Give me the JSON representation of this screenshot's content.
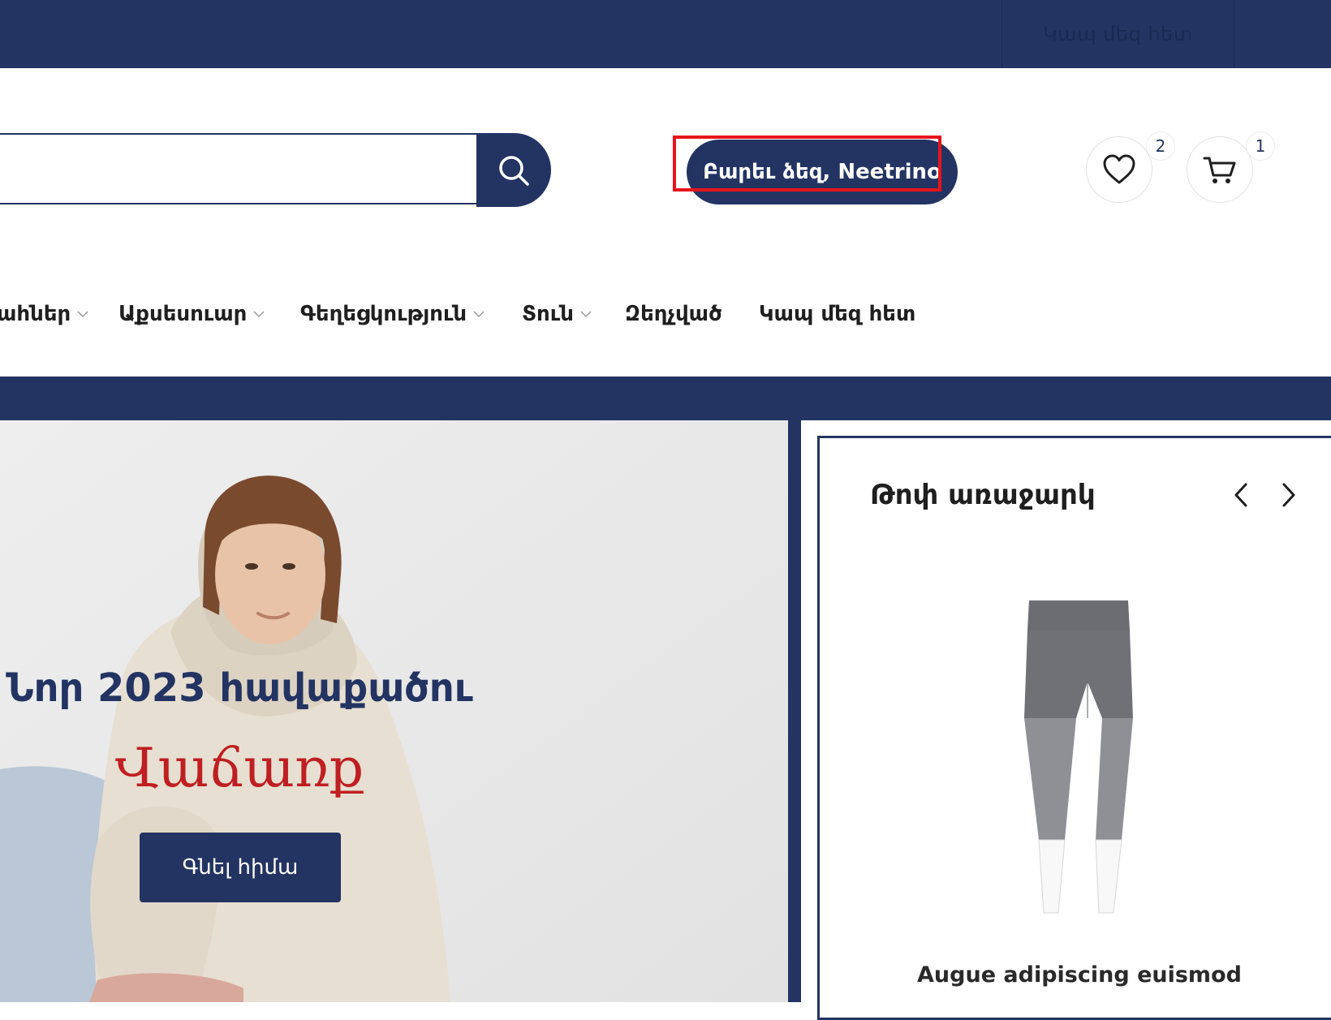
{
  "topbar": {
    "contact_link": "Կապ մեզ հետ",
    "color": "#233463"
  },
  "header": {
    "search": {
      "placeholder": "",
      "value": ""
    },
    "greeting": "Բարեւ ձեզ, Neetrino",
    "wishlist": {
      "icon": "heart-icon",
      "count": "2"
    },
    "cart": {
      "icon": "cart-icon",
      "count": "1"
    }
  },
  "nav": {
    "items": [
      {
        "label": "ահներ",
        "has_dropdown": true
      },
      {
        "label": "Աքսեսուար",
        "has_dropdown": true
      },
      {
        "label": "Գեղեցկություն",
        "has_dropdown": true
      },
      {
        "label": "Տուն",
        "has_dropdown": true
      },
      {
        "label": "Զեղչված",
        "has_dropdown": false
      },
      {
        "label": "Կապ մեզ հետ",
        "has_dropdown": false
      }
    ]
  },
  "hero": {
    "title": "Նոր 2023 հավաքածու",
    "subtitle": "Վաճառք",
    "button": "Գնել հիմա",
    "accent_color": "#bf1f21"
  },
  "offer": {
    "title": "Թոփ առաջարկ",
    "product_name": "Augue adipiscing euismod"
  }
}
